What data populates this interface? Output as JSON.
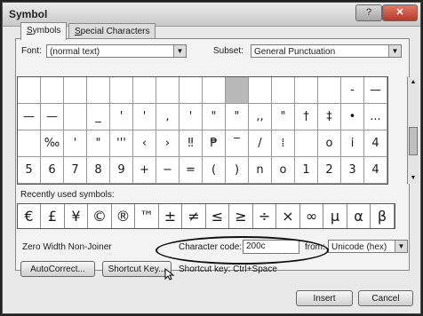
{
  "window": {
    "title": "Symbol",
    "help": "?",
    "close": "✕"
  },
  "tabs": [
    {
      "label_first": "S",
      "label_rest": "ymbols"
    },
    {
      "label_first": "S",
      "label_rest": "pecial Characters"
    }
  ],
  "font": {
    "label": "Font:",
    "value": "(normal text)"
  },
  "subset": {
    "label": "Subset:",
    "value": "General Punctuation"
  },
  "grid_rows": [
    [
      "",
      "",
      "",
      "",
      "",
      "",
      "",
      "",
      "",
      "",
      "",
      "",
      "",
      "",
      "-",
      "—"
    ],
    [
      "—",
      "—",
      "",
      "_",
      "'",
      "'",
      ",",
      "'",
      "\"",
      "\"",
      ",,",
      "\"",
      "†",
      "‡",
      "•",
      "..."
    ],
    [
      "",
      "‰",
      "'",
      "\"",
      "'''",
      "‹",
      "›",
      "‼",
      "₱",
      "‾",
      "/",
      "⁞",
      "",
      "o",
      "i",
      "4"
    ],
    [
      "5",
      "6",
      "7",
      "8",
      "9",
      "+",
      "−",
      "=",
      "(",
      ")",
      "n",
      "o",
      "1",
      "2",
      "3",
      "4"
    ]
  ],
  "highlight": {
    "row": 0,
    "col": 9
  },
  "recent": {
    "label": "Recently used symbols:",
    "symbols": [
      "€",
      "£",
      "¥",
      "©",
      "®",
      "™",
      "±",
      "≠",
      "≤",
      "≥",
      "÷",
      "×",
      "∞",
      "µ",
      "α",
      "β"
    ]
  },
  "char_name": "Zero Width Non-Joiner",
  "char_code": {
    "label": "Character code:",
    "value": "200c"
  },
  "from": {
    "label": "from:",
    "value": "Unicode (hex)"
  },
  "buttons": {
    "autocorrect": "AutoCorrect...",
    "shortcut_key": "Shortcut Key...",
    "shortcut_text": "Shortcut key: Ctrl+Space",
    "insert": "Insert",
    "cancel": "Cancel"
  }
}
